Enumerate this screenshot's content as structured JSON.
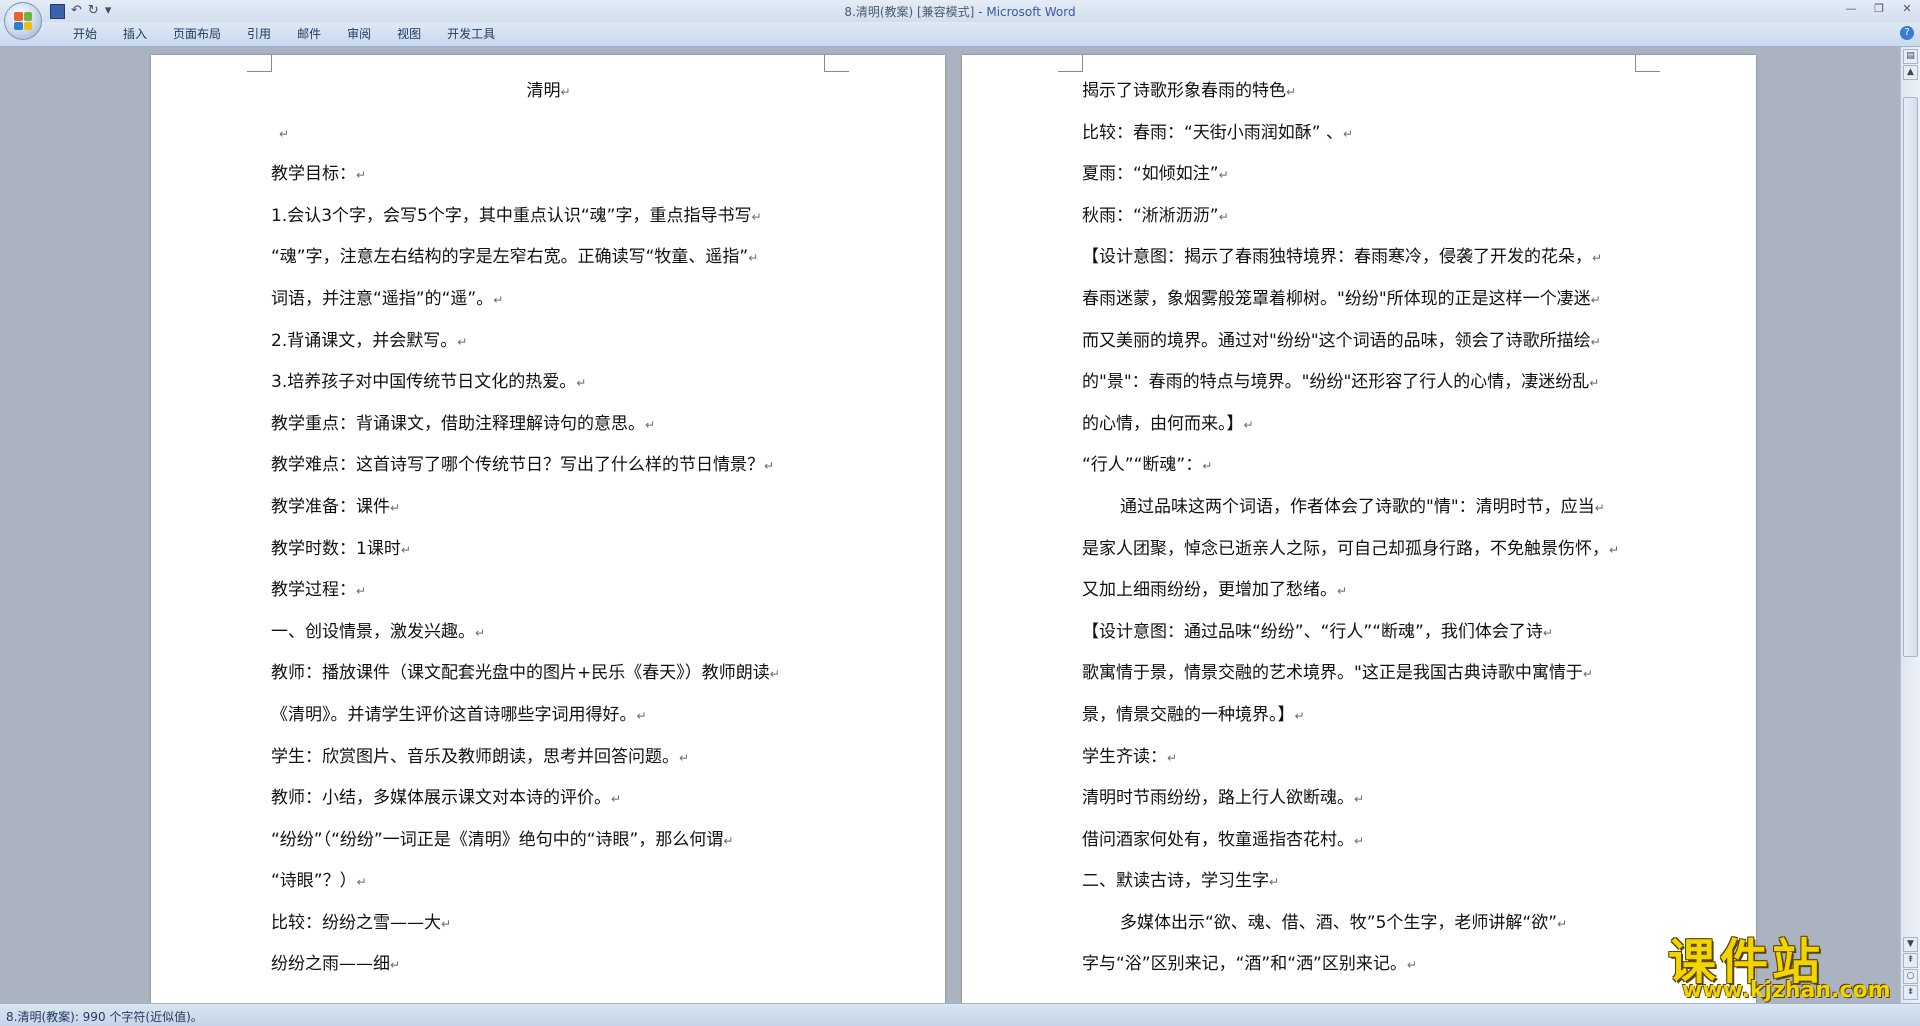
{
  "window": {
    "title": "8.清明(教案) [兼容模式]",
    "separator": " - ",
    "product": "Microsoft Word"
  },
  "ribbon": {
    "tabs": [
      "开始",
      "插入",
      "页面布局",
      "引用",
      "邮件",
      "审阅",
      "视图",
      "开发工具"
    ]
  },
  "pages": {
    "left": [
      "清明",
      "",
      "教学目标：",
      "1.会认3个字，会写5个字，其中重点认识“魂”字，重点指导书写",
      "“魂”字，注意左右结构的字是左窄右宽。正确读写“牧童、遥指”",
      "词语，并注意“遥指”的“遥”。",
      "2.背诵课文，并会默写。",
      "3.培养孩子对中国传统节日文化的热爱。",
      "教学重点：背诵课文，借助注释理解诗句的意思。",
      "教学难点：这首诗写了哪个传统节日？写出了什么样的节日情景？",
      "教学准备：课件",
      "教学时数：1课时",
      "教学过程：",
      "一、创设情景，激发兴趣。",
      "教师：播放课件（课文配套光盘中的图片+民乐《春天》）教师朗读",
      "《清明》。并请学生评价这首诗哪些字词用得好。",
      "学生：欣赏图片、音乐及教师朗读，思考并回答问题。",
      "教师：小结，多媒体展示课文对本诗的评价。",
      "“纷纷”（“纷纷”一词正是《清明》绝句中的“诗眼”，那么何谓",
      "“诗眼”？）",
      "比较：纷纷之雪——大",
      "纷纷之雨——细"
    ],
    "right": [
      "揭示了诗歌形象春雨的特色",
      "比较：春雨：“天街小雨润如酥”  、",
      "夏雨：“如倾如注”",
      "秋雨：“淅淅沥沥”",
      "【设计意图：揭示了春雨独特境界：春雨寒冷，侵袭了开发的花朵，",
      "春雨迷蒙，象烟雾般笼罩着柳树。\"纷纷\"所体现的正是这样一个凄迷",
      "而又美丽的境界。通过对\"纷纷\"这个词语的品味，领会了诗歌所描绘",
      "的\"景\"：春雨的特点与境界。\"纷纷\"还形容了行人的心情，凄迷纷乱",
      "的心情，由何而来。】",
      "“行人”“断魂”：",
      "通过品味这两个词语，作者体会了诗歌的\"情\"：清明时节，应当",
      "是家人团聚，悼念已逝亲人之际，可自己却孤身行路，不免触景伤怀，",
      "又加上细雨纷纷，更增加了愁绪。",
      "【设计意图：通过品味“纷纷”、“行人”“断魂”，我们体会了诗",
      "歌寓情于景，情景交融的艺术境界。\"这正是我国古典诗歌中寓情于",
      "景，情景交融的一种境界。】",
      "学生齐读：",
      "清明时节雨纷纷，路上行人欲断魂。",
      "借问酒家何处有，牧童遥指杏花村。",
      "二、默读古诗，学习生字",
      "多媒体出示“欲、魂、借、酒、牧”5个生字，老师讲解“欲”",
      "字与“浴”区别来记，“酒”和“洒”区别来记。"
    ]
  },
  "status": {
    "text": "8.清明(教案): 990 个字符(近似值)。"
  },
  "watermark": {
    "title": "课件站",
    "url": "www.kjzhan.com"
  },
  "colors": {
    "workspace": "#abb3c0",
    "ribbon": "#c9d9ee",
    "watermark": "#f2d400"
  }
}
